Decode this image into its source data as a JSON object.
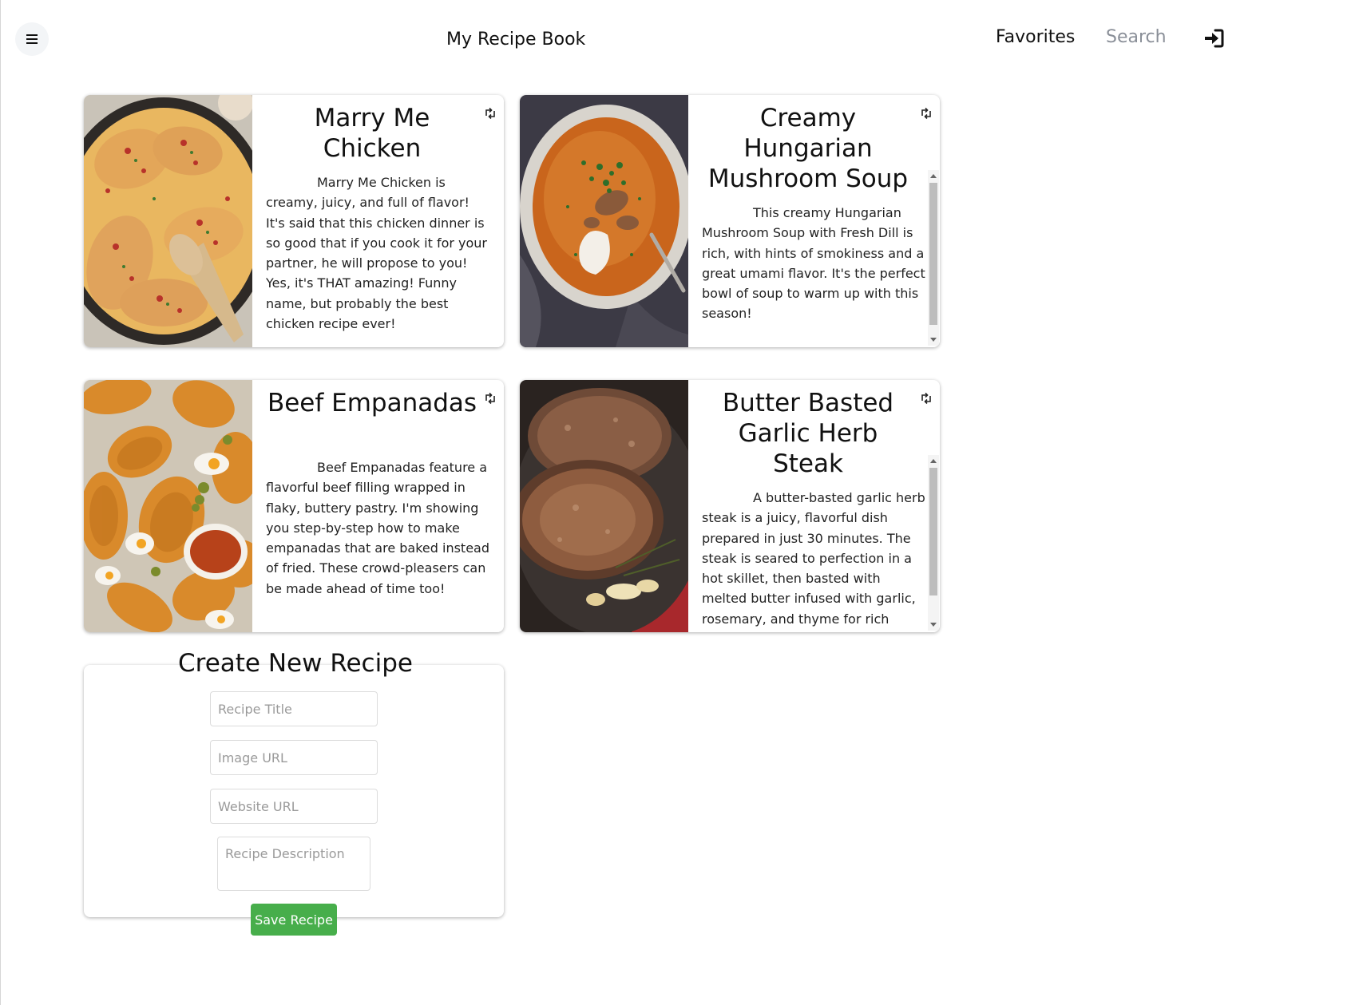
{
  "header": {
    "title": "My Recipe Book",
    "nav_favorites": "Favorites",
    "nav_search": "Search",
    "menu_icon": "hamburger-icon",
    "login_icon": "sign-in-icon"
  },
  "recipes": [
    {
      "title": "Marry Me Chicken",
      "image": "creamy chicken breasts in skillet",
      "description": "Marry Me Chicken is creamy, juicy, and full of flavor! It's said that this chicken dinner is so good that if you cook it for your partner, he will propose to you! Yes, it's THAT amazing! Funny name, but probably the best chicken recipe ever!"
    },
    {
      "title": "Creamy Hungarian Mushroom Soup",
      "image": "bowl of mushroom soup with dill",
      "description": "This creamy Hungarian Mushroom Soup with Fresh Dill is rich, with hints of smokiness and a great umami flavor. It's the perfect bowl of soup to warm up with this season!"
    },
    {
      "title": "Beef Empanadas",
      "image": "tray of baked empanadas",
      "description": "Beef Empanadas feature a flavorful beef filling wrapped in flaky, buttery pastry. I'm showing you step-by-step how to make empanadas that are baked instead of fried. These crowd-pleasers can be made ahead of time too!"
    },
    {
      "title": "Butter Basted Garlic Herb Steak",
      "image": "seared steaks in skillet with herbs",
      "description": "A butter-basted garlic herb steak is a juicy, flavorful dish prepared in just 30 minutes. The steak is seared to perfection in a hot skillet, then basted with melted butter infused with garlic, rosemary, and thyme for rich flavor."
    }
  ],
  "flip_icon": "flip-icon",
  "create_form": {
    "heading": "Create New Recipe",
    "title_placeholder": "Recipe Title",
    "image_placeholder": "Image URL",
    "website_placeholder": "Website URL",
    "description_placeholder": "Recipe Description",
    "save_label": "Save Recipe"
  },
  "colors": {
    "save_button": "#47ae4b",
    "search_link": "#8a8f98"
  }
}
